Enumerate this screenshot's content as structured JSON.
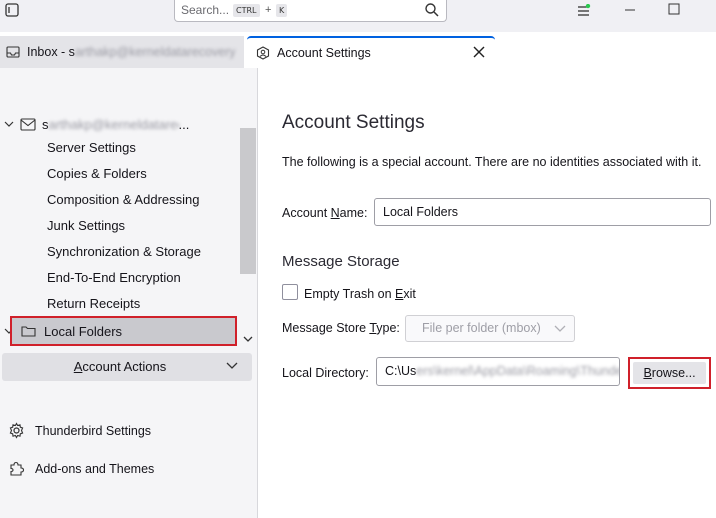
{
  "titlebar": {
    "search_placeholder": "Search...",
    "shortcut_ctrl": "CTRL",
    "shortcut_plus": "+",
    "shortcut_key": "K",
    "menu_badge_color": "#2ac94f"
  },
  "tabs": [
    {
      "label_visible": "Inbox - s",
      "label_blurred": "arthakp@kerneldatarecovery.c",
      "label_tail": "ery.c",
      "icon": "inbox-icon"
    },
    {
      "label": "Account Settings",
      "icon": "account-settings-icon",
      "active": true
    }
  ],
  "sidebar": {
    "account": {
      "prefix": "s",
      "blurred": "arthakp@kerneldatarecovery",
      "suffix": "..."
    },
    "items": [
      "Server Settings",
      "Copies & Folders",
      "Composition & Addressing",
      "Junk Settings",
      "Synchronization & Storage",
      "End-To-End Encryption",
      "Return Receipts"
    ],
    "local_folders": "Local Folders",
    "account_actions_pre": "",
    "account_actions_underline": "A",
    "account_actions_post": "ccount Actions",
    "footer": [
      {
        "label": "Thunderbird Settings",
        "icon": "gear-icon"
      },
      {
        "label": "Add-ons and Themes",
        "icon": "puzzle-icon"
      }
    ]
  },
  "main": {
    "title": "Account Settings",
    "info": "The following is a special account. There are no identities associated with it.",
    "account_name_pre": "Account ",
    "account_name_u": "N",
    "account_name_post": "ame:",
    "account_name_value": "Local Folders",
    "storage_title": "Message Storage",
    "empty_trash_pre": "Empty Trash on ",
    "empty_trash_u": "E",
    "empty_trash_post": "xit",
    "store_type_pre": "Message Store ",
    "store_type_u": "T",
    "store_type_post": "ype:",
    "store_type_value": "File per folder (mbox)",
    "local_dir_label": "Local Directory:",
    "local_dir_prefix": "C:\\Us",
    "local_dir_blurred": "ers\\kernel\\AppData\\Roaming\\Thunderbird\\",
    "browse_u": "B",
    "browse_post": "rowse..."
  },
  "colors": {
    "accent": "#0061e0",
    "highlight_border": "#d0202a",
    "sidebar_bg": "#f5f5f7"
  }
}
